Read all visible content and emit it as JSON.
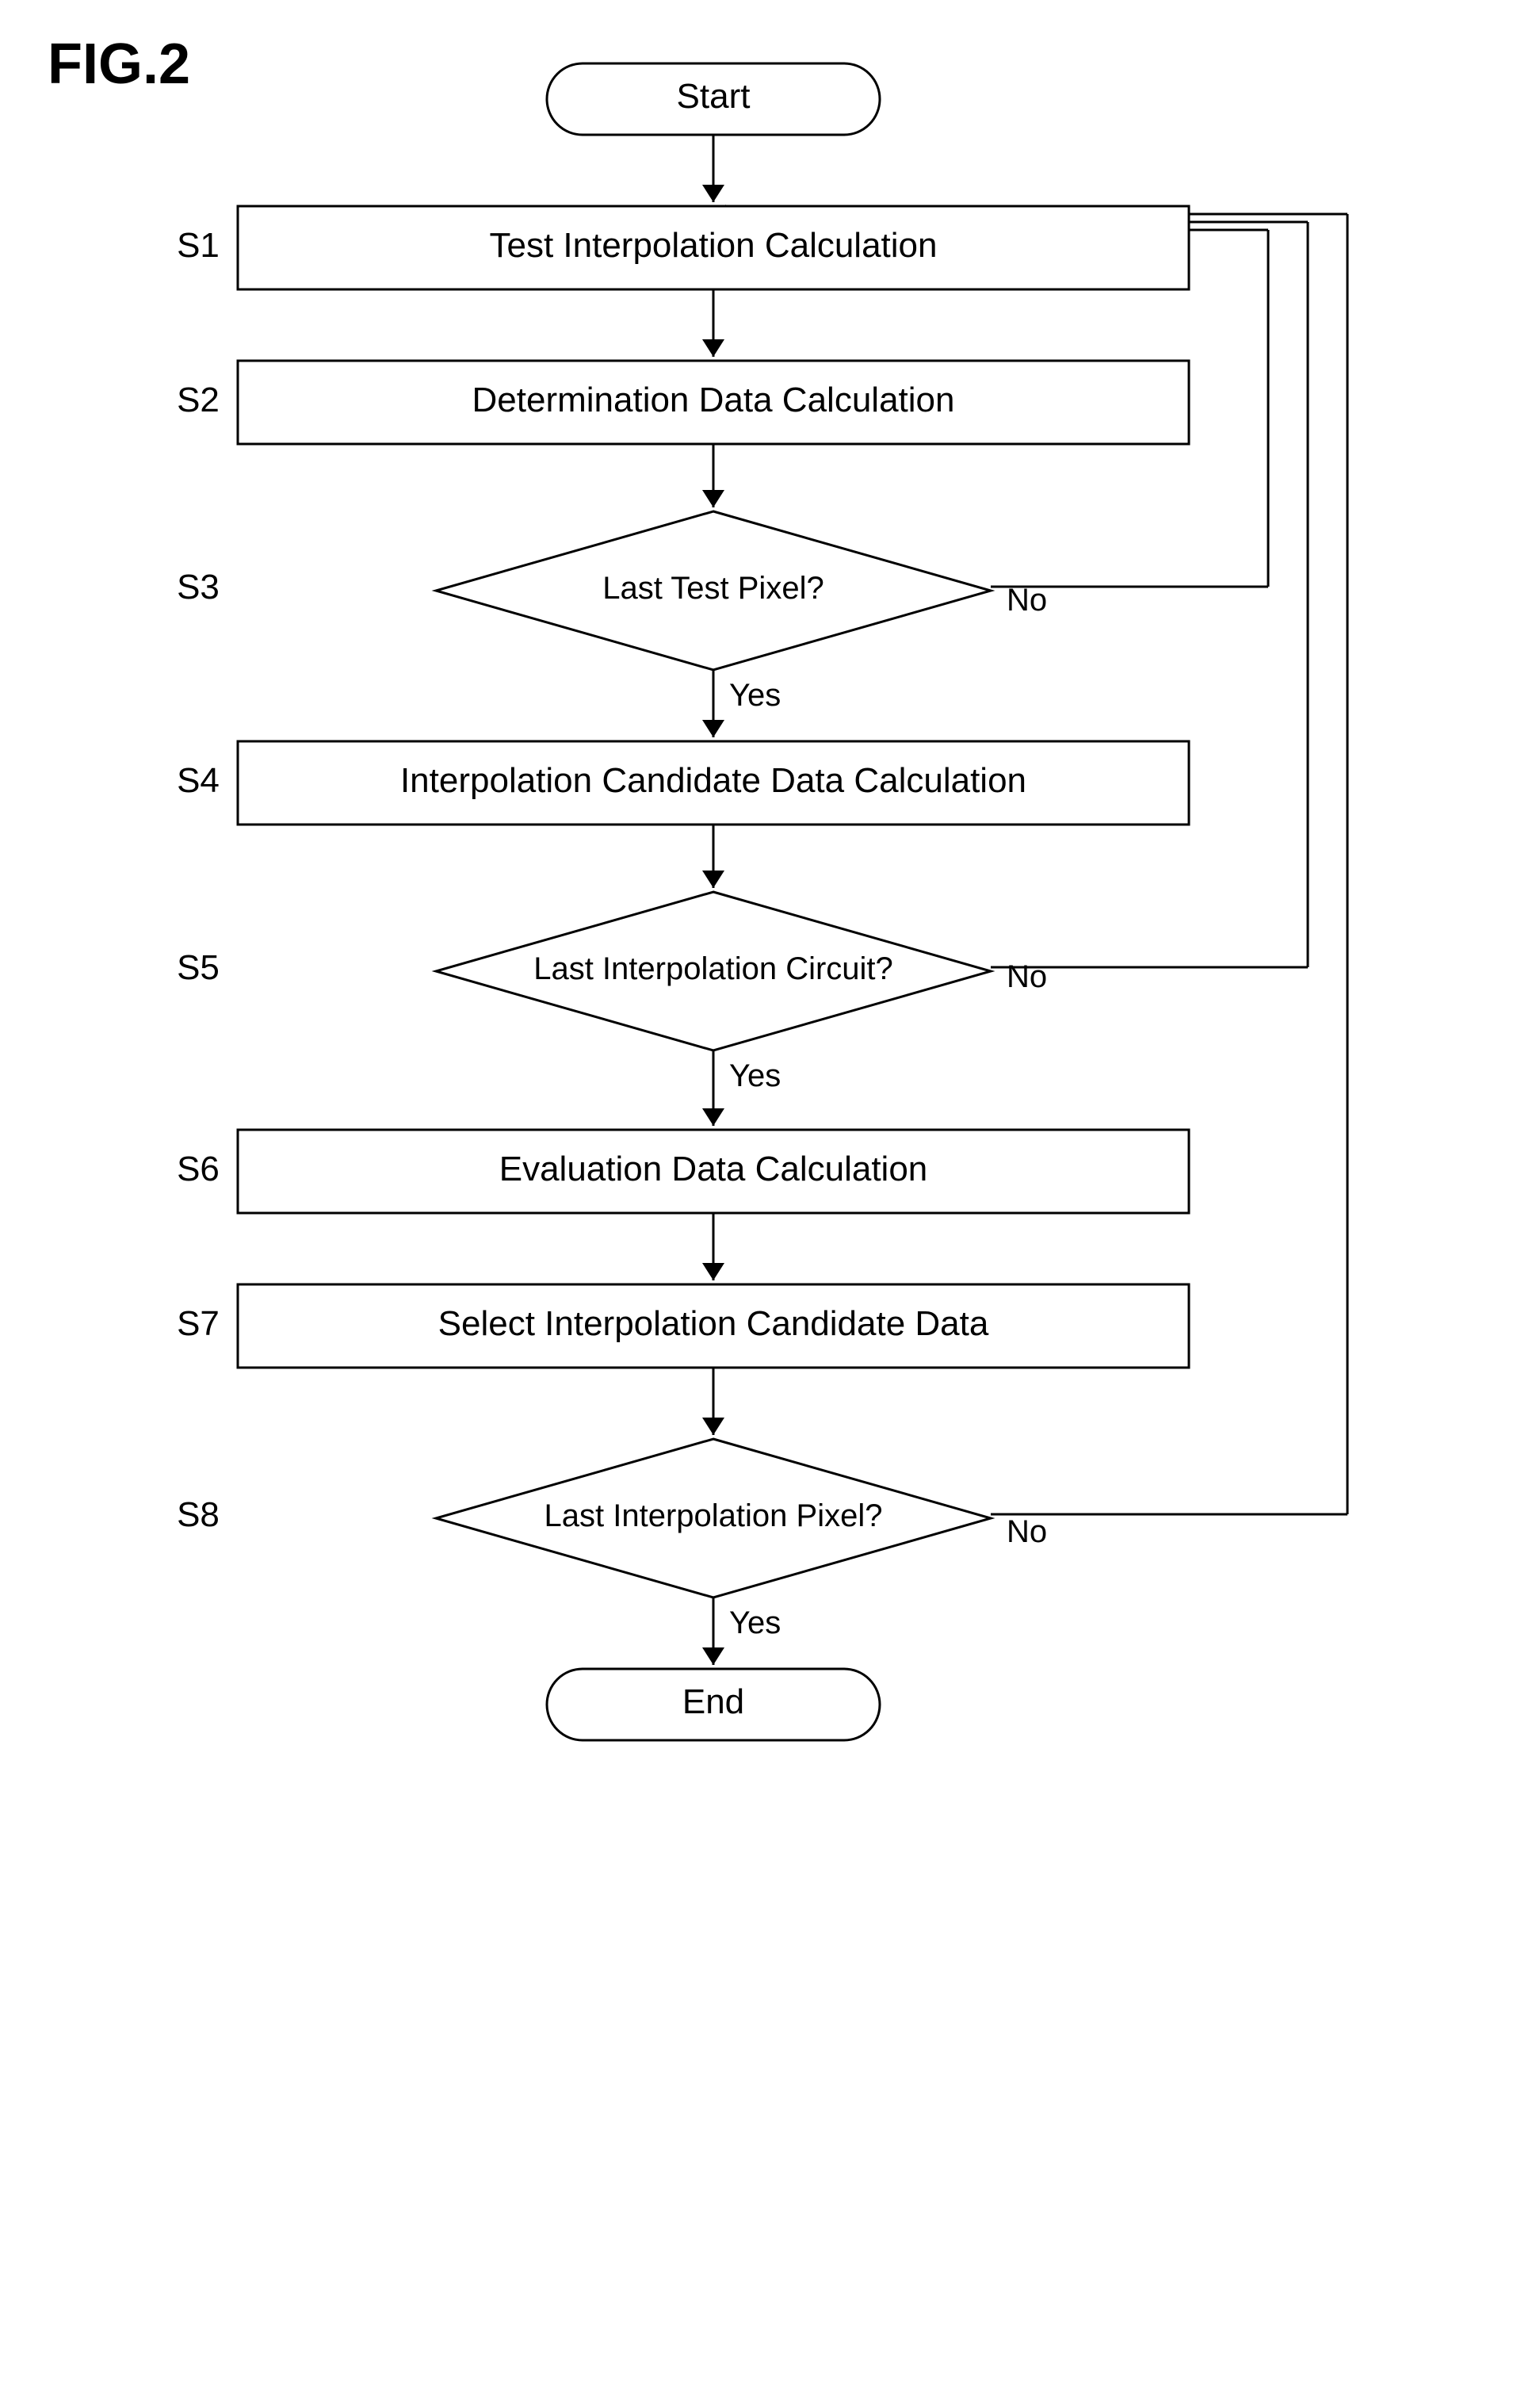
{
  "figure": {
    "label": "FIG.2"
  },
  "flowchart": {
    "start_label": "Start",
    "end_label": "End",
    "steps": [
      {
        "id": "S1",
        "type": "process",
        "text": "Test Interpolation Calculation"
      },
      {
        "id": "S2",
        "type": "process",
        "text": "Determination Data Calculation"
      },
      {
        "id": "S3",
        "type": "decision",
        "text": "Last Test Pixel?",
        "yes": "Yes",
        "no": "No"
      },
      {
        "id": "S4",
        "type": "process",
        "text": "Interpolation Candidate Data Calculation"
      },
      {
        "id": "S5",
        "type": "decision",
        "text": "Last Interpolation Circuit?",
        "yes": "Yes",
        "no": "No"
      },
      {
        "id": "S6",
        "type": "process",
        "text": "Evaluation Data Calculation"
      },
      {
        "id": "S7",
        "type": "process",
        "text": "Select Interpolation Candidate Data"
      },
      {
        "id": "S8",
        "type": "decision",
        "text": "Last Interpolation Pixel?",
        "yes": "Yes",
        "no": "No"
      }
    ]
  }
}
